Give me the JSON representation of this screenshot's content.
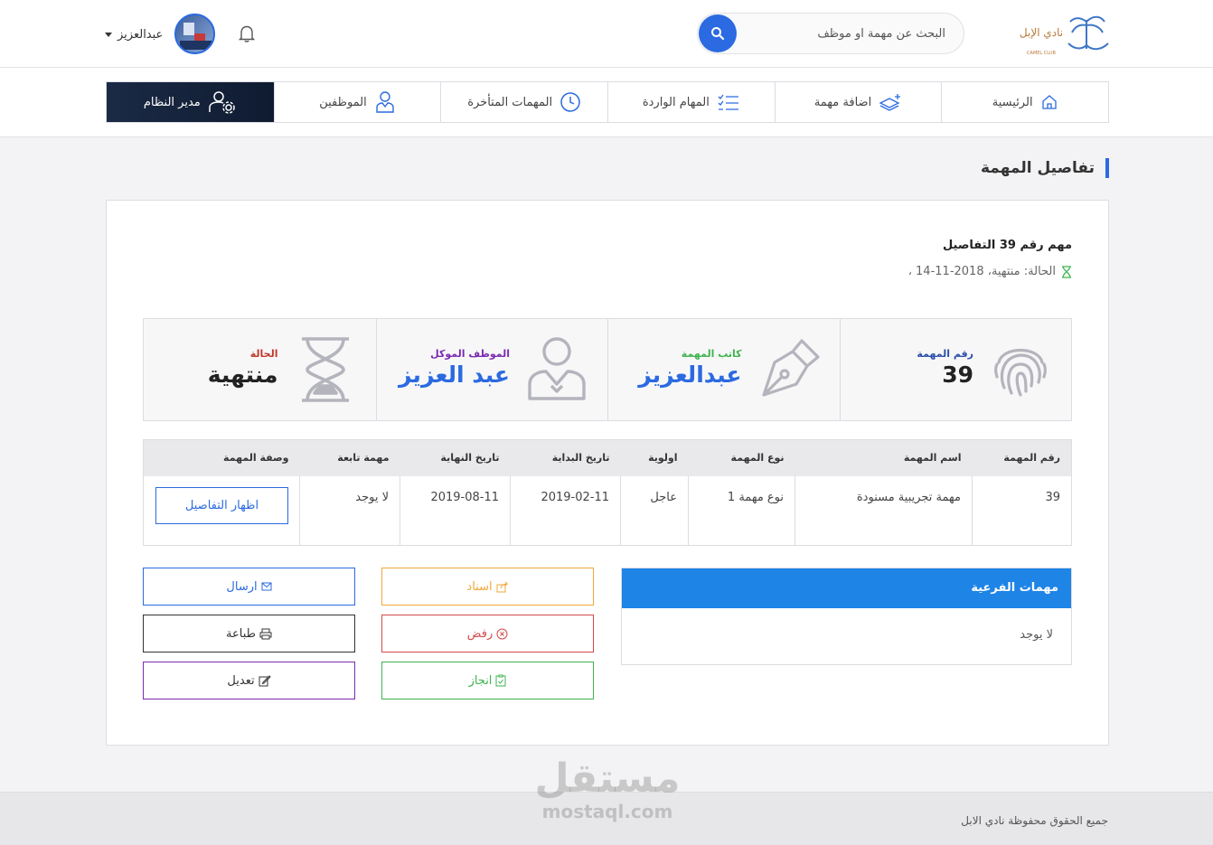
{
  "header": {
    "logo_text": "نادي الإبل",
    "logo_subtext": "CAMEL CLUB",
    "search_placeholder": "البحث عن مهمة او موظف",
    "user_name": "عبدالعزيز"
  },
  "nav": {
    "items": [
      {
        "label": "الرئيسية",
        "icon": "home-icon"
      },
      {
        "label": "اضافة مهمة",
        "icon": "add-task-icon"
      },
      {
        "label": "المهام الواردة",
        "icon": "checklist-icon"
      },
      {
        "label": "المهمات المتأخرة",
        "icon": "clock-icon"
      },
      {
        "label": "الموظفين",
        "icon": "employees-icon"
      },
      {
        "label": "مدير النظام",
        "icon": "admin-gear-icon"
      }
    ]
  },
  "page": {
    "title": "تفاصيل المهمة",
    "task_heading": "مهم رقم 39 التفاصيل",
    "task_status_line": "الحالة: منتهية، 2018-11-14 ،"
  },
  "stats": {
    "task_number": {
      "label": "رقم المهمة",
      "value": "39",
      "color": "#2b4fa8"
    },
    "task_writer": {
      "label": "كاتب المهمة",
      "value": "عبدالعزيز",
      "color": "#3fb34f"
    },
    "assigned_employee": {
      "label": "الموظف الموكل",
      "value": "عبد العزيز",
      "color": "#7b2bb0"
    },
    "status": {
      "label": "الحالة",
      "value": "منتهية",
      "color": "#c0392b"
    }
  },
  "table": {
    "headers": [
      "رقم المهمة",
      "اسم المهمة",
      "نوع المهمة",
      "اولوية",
      "تاريخ البداية",
      "تاريخ النهاية",
      "مهمة تابعة",
      "وصفة المهمة"
    ],
    "row": {
      "number": "39",
      "name": "مهمة تجريبية مسنودة",
      "type": "نوع مهمة 1",
      "priority": "عاجل",
      "start": "2019-02-11",
      "end": "2019-08-11",
      "parent": "لا يوجد",
      "details_button": "اظهار التفاصيل"
    }
  },
  "subtasks": {
    "title": "مهمات الفرعية",
    "empty": "لا يوجد"
  },
  "actions": {
    "send": "ارسال",
    "print": "طباعة",
    "edit": "تعديل",
    "assign": "اسناد",
    "reject": "رفض",
    "done": "انجاز"
  },
  "footer": {
    "copyright": "جميع الحقوق محفوظة نادي الابل",
    "watermark_ar": "مستقل",
    "watermark_en": "mostaql.com"
  },
  "colors": {
    "primary": "#2b6ae0",
    "nav_active": "#1b2a45",
    "subtasks_header": "#1e84e6"
  }
}
